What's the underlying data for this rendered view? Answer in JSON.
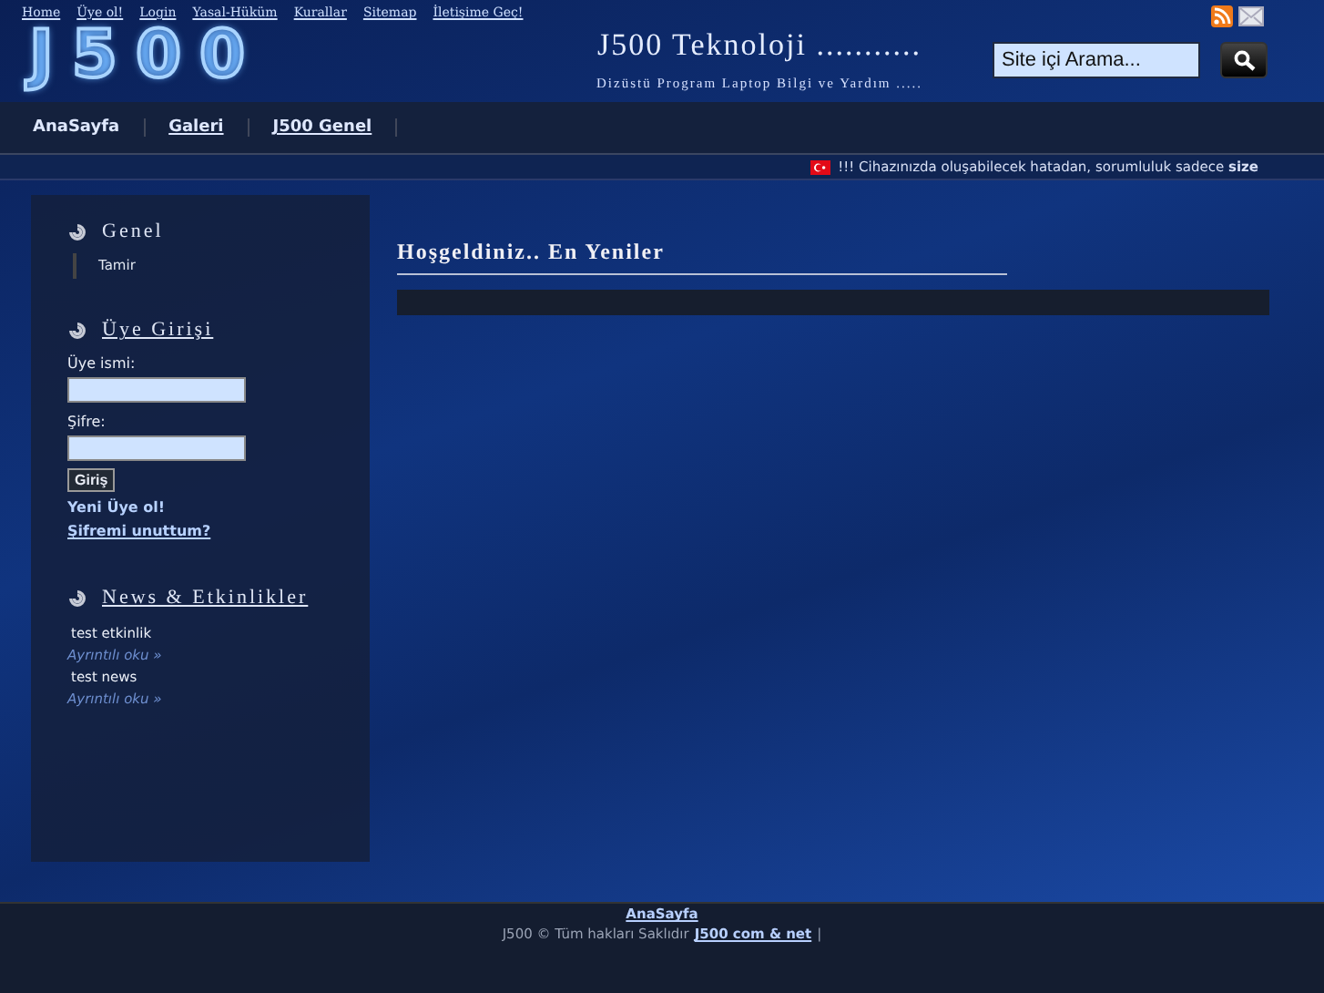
{
  "top_links": [
    "Home",
    "Üye ol!",
    "Login",
    "Yasal-Hüküm",
    "Kurallar",
    "Sitemap",
    "İletişime Geç!"
  ],
  "logo": "J500",
  "site": {
    "title": "J500 Teknoloji ...........",
    "subtitle": "Dizüstü Program Laptop Bilgi ve Yardım ....."
  },
  "search": {
    "placeholder": "Site içi Arama..."
  },
  "nav": [
    {
      "label": "AnaSayfa",
      "selected": true
    },
    {
      "label": "Galeri",
      "selected": false
    },
    {
      "label": "J500 Genel",
      "selected": false
    }
  ],
  "notice": {
    "text": "!!! Cihazınızda oluşabilecek hatadan, sorumluluk sadece **size**"
  },
  "sidebar": {
    "genel": {
      "title": "Genel",
      "items": [
        "Tamir"
      ]
    },
    "login": {
      "title": "Üye Girişi",
      "username_label": "Üye ismi:",
      "password_label": "Şifre:",
      "submit": "Giriş",
      "register": "Yeni Üye ol!",
      "forgot": "Şifremi unuttum?"
    },
    "news": {
      "title": "News & Etkinlikler",
      "items": [
        {
          "title": "test etkinlik",
          "more": "Ayrıntılı oku »"
        },
        {
          "title": "test news",
          "more": "Ayrıntılı oku »"
        }
      ]
    }
  },
  "main": {
    "heading": "Hoşgeldiniz.. En Yeniler"
  },
  "footer": {
    "link": "AnaSayfa",
    "copyright": "J500 © Tüm hakları Saklıdır",
    "site_link": "J500 com & net",
    "separator": "|"
  }
}
